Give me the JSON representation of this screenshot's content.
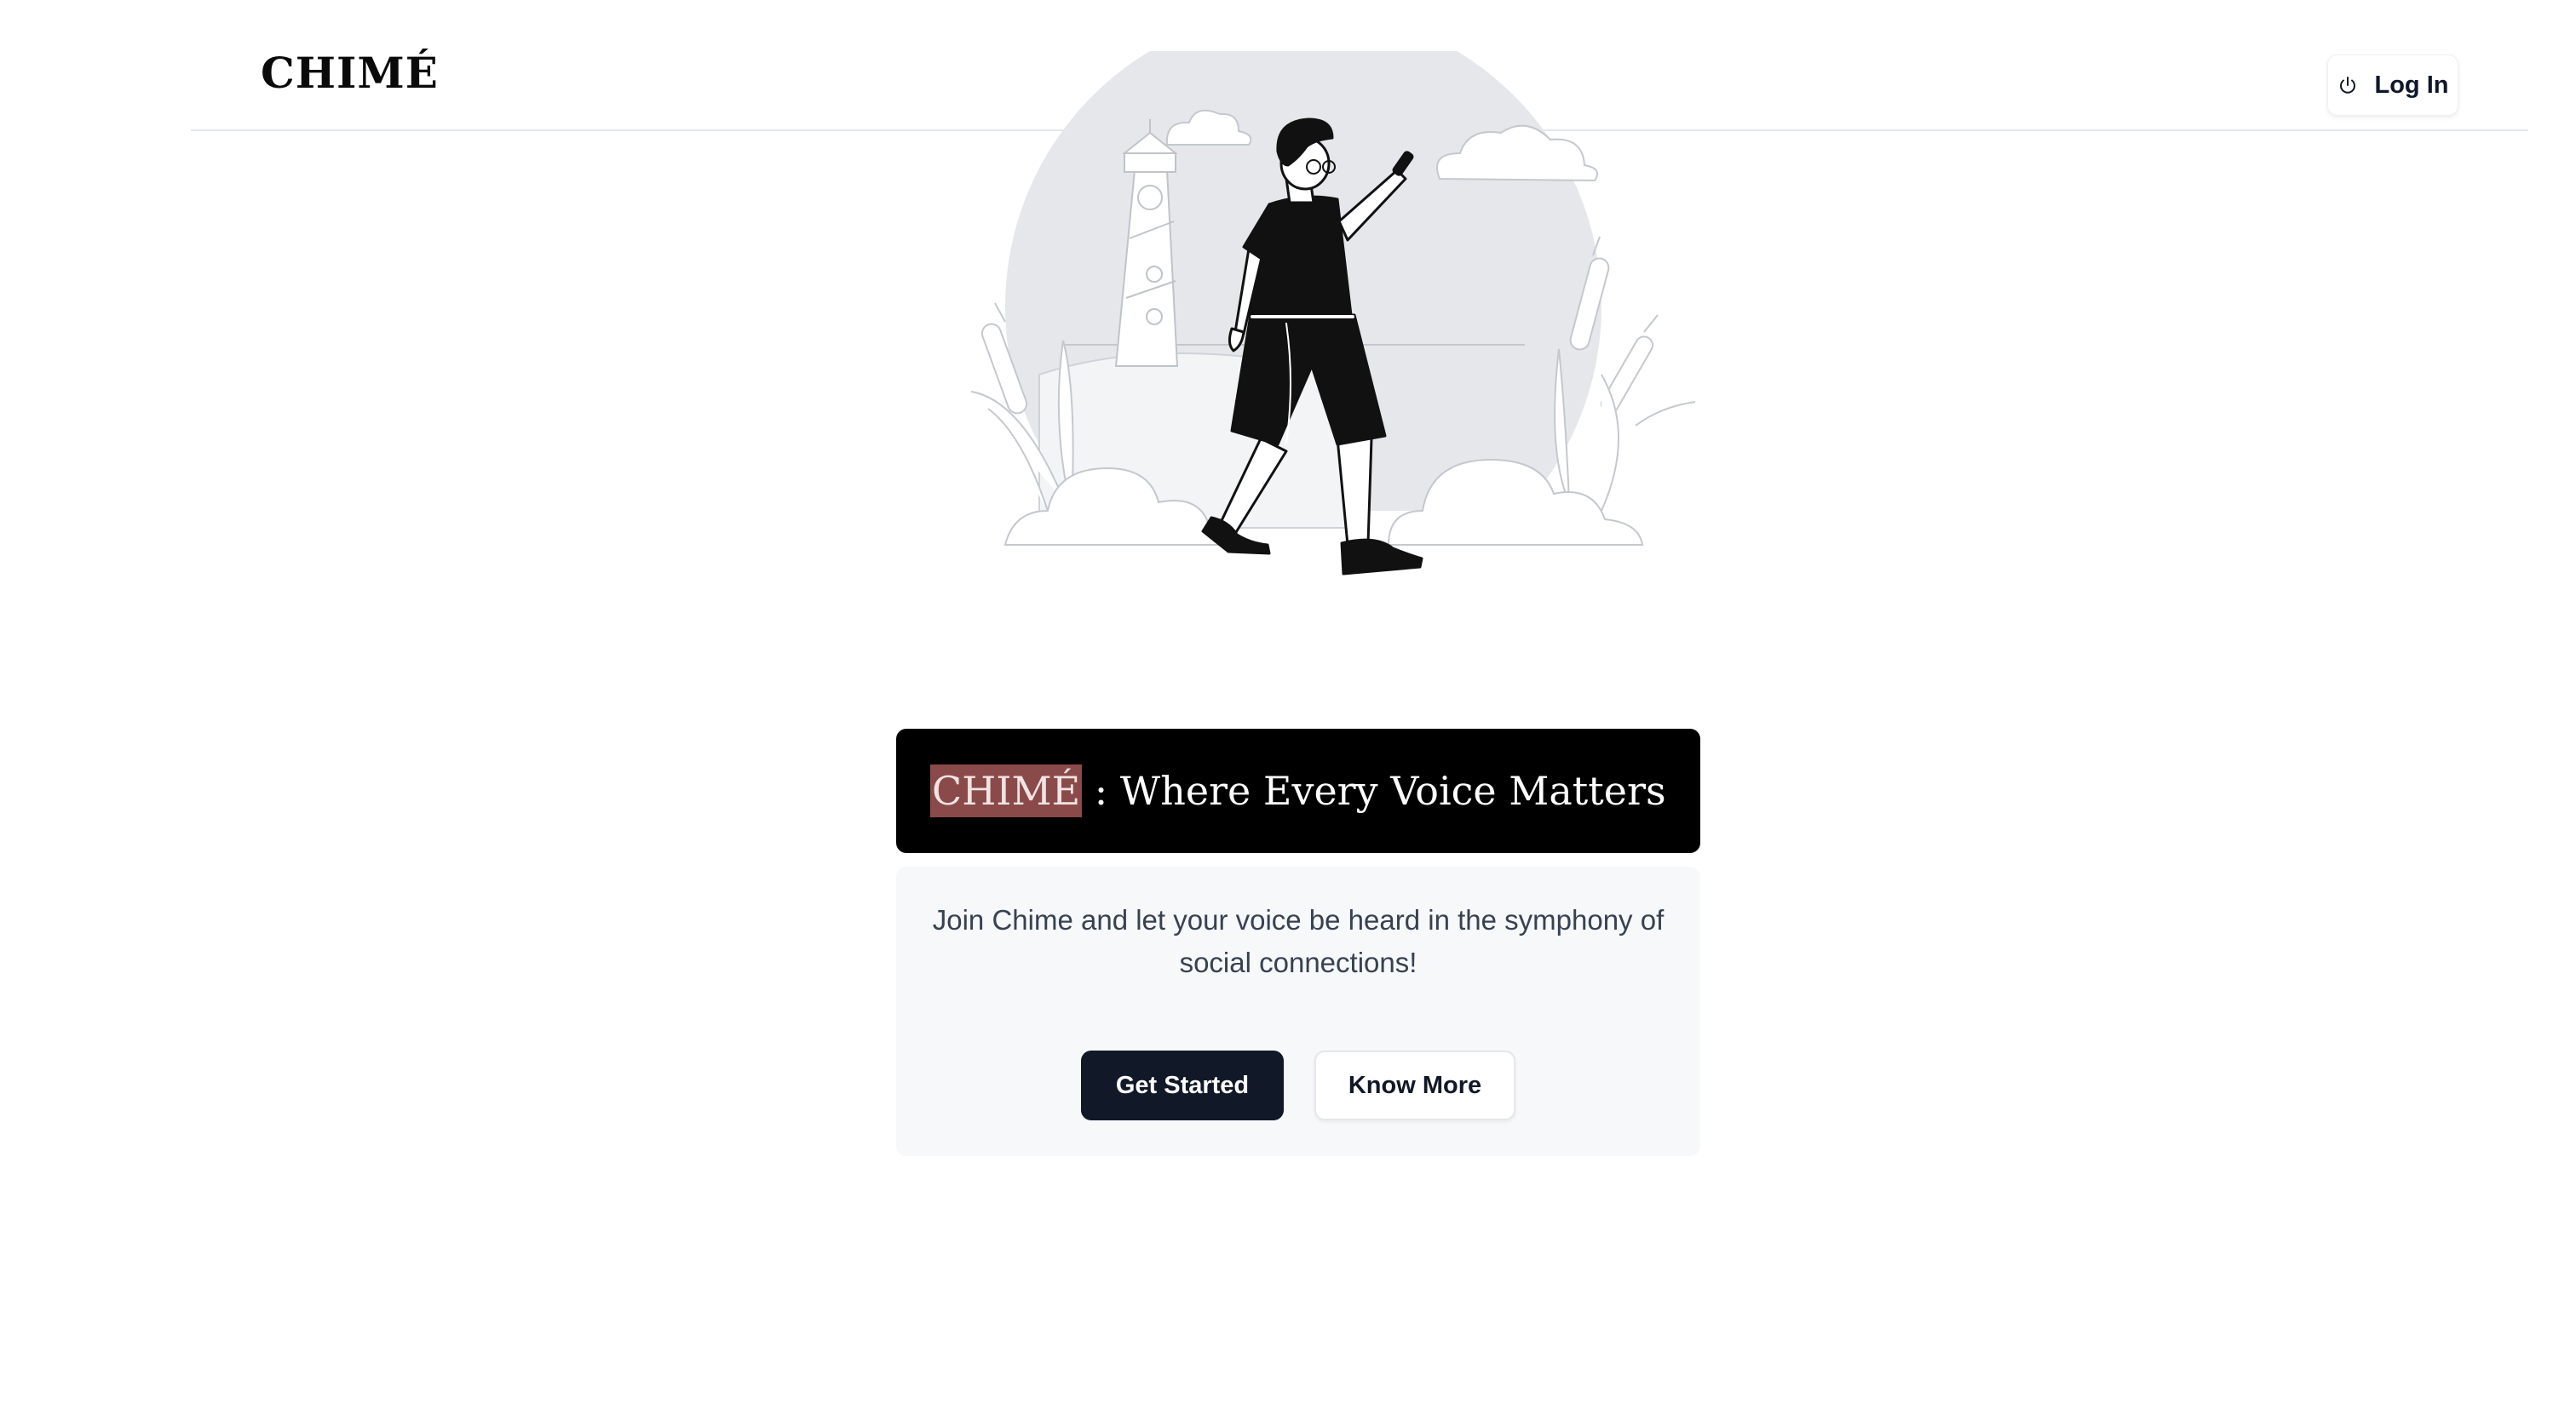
{
  "header": {
    "brand": "CHIMÉ",
    "login_label": "Log In",
    "login_icon": "power-icon"
  },
  "hero": {
    "illustration": "person-walking-illustration"
  },
  "headline": {
    "brand": "CHIMÉ",
    "text": " : Where Every Voice Matters"
  },
  "intro": {
    "tagline": "Join Chime and let your voice be heard in the symphony of social connections!",
    "primary_label": "Get Started",
    "secondary_label": "Know More"
  },
  "colors": {
    "headline_bg": "#000000",
    "brand_highlight": "#8b4a4a",
    "primary_button": "#111827",
    "card_bg": "#f7f8fa"
  }
}
